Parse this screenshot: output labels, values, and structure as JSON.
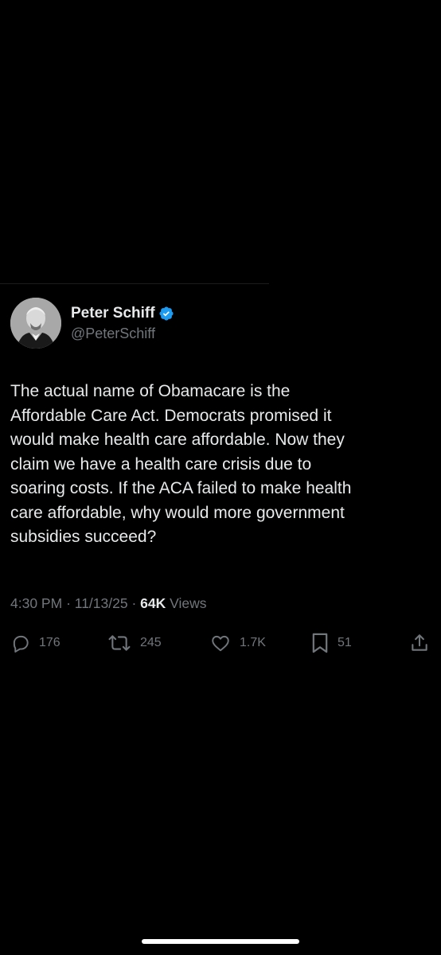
{
  "colors": {
    "background": "#000000",
    "primary_text": "#e7e9ea",
    "secondary_text": "#71767b",
    "verified_badge": "#1d9bf0"
  },
  "author": {
    "display_name": "Peter Schiff",
    "handle": "@PeterSchiff",
    "verified": true,
    "avatar_icon": "profile-photo"
  },
  "tweet": {
    "text": "The actual name of Obamacare is the\nAffordable Care Act. Democrats promised it\nwould make health care affordable. Now they\nclaim we have a health care crisis due to\nsoaring costs. If the ACA failed to make health\ncare affordable, why would more government\nsubsidies succeed?",
    "time": "4:30 PM",
    "date": "11/13/25",
    "separator": "·",
    "views_count": "64K",
    "views_label": "Views"
  },
  "actions": {
    "replies": {
      "icon": "reply-icon",
      "count": "176"
    },
    "reposts": {
      "icon": "repost-icon",
      "count": "245"
    },
    "likes": {
      "icon": "heart-icon",
      "count": "1.7K"
    },
    "bookmarks": {
      "icon": "bookmark-icon",
      "count": "51"
    },
    "share": {
      "icon": "share-icon"
    }
  }
}
